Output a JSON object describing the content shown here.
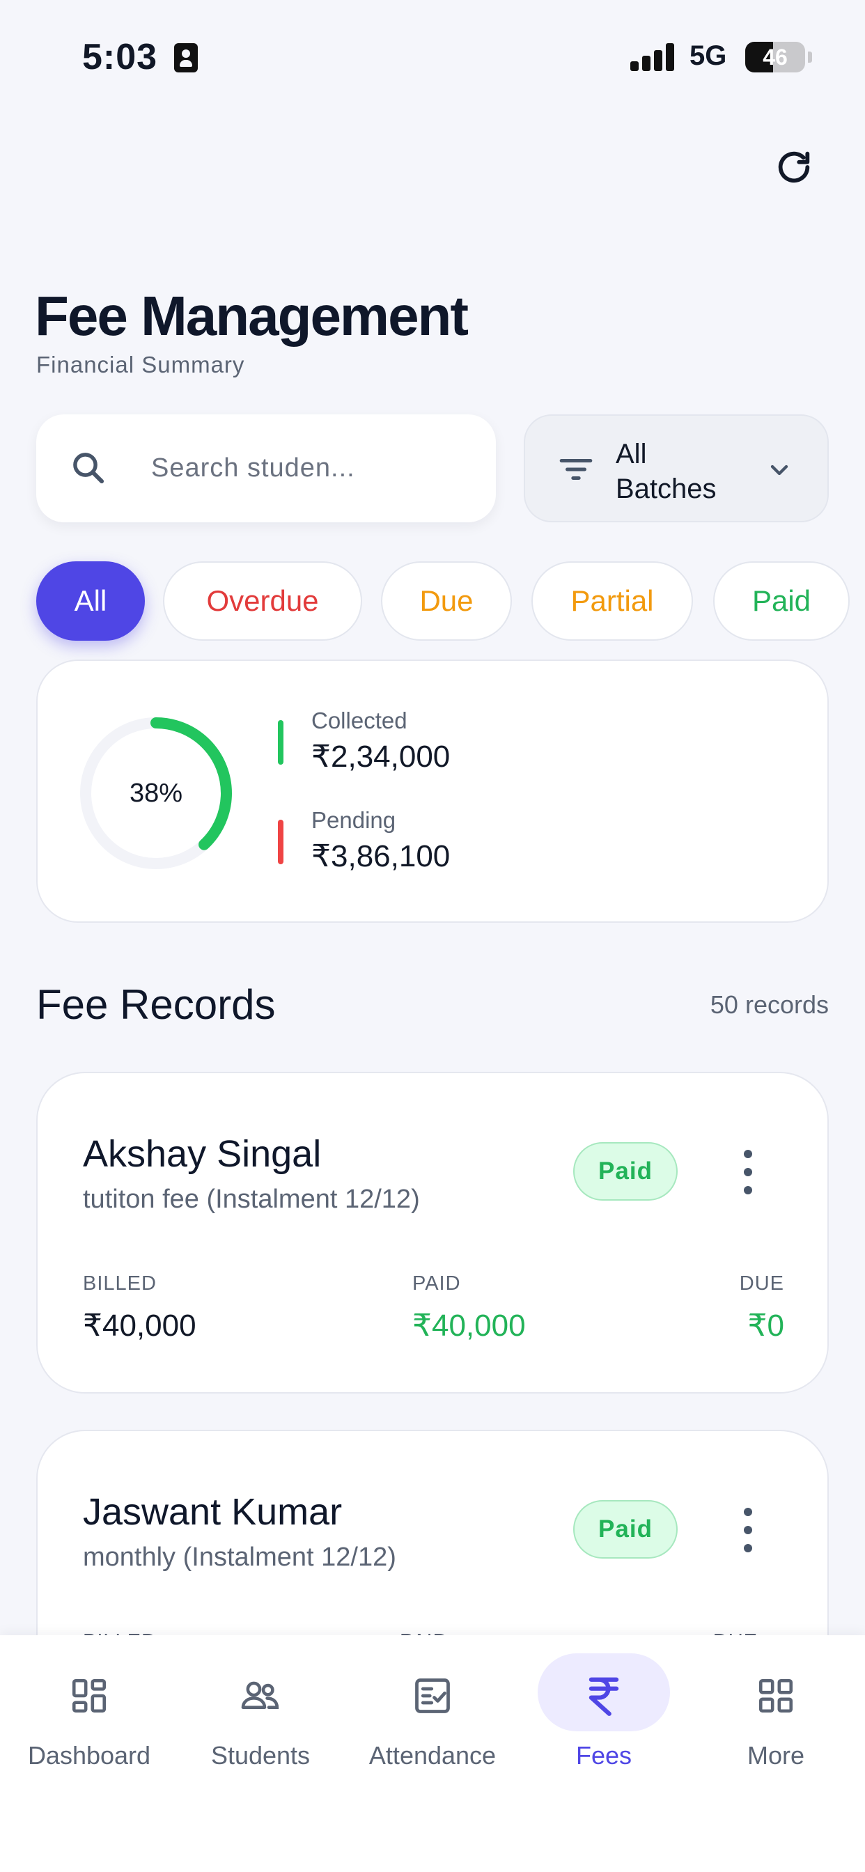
{
  "status_bar": {
    "time": "5:03",
    "network": "5G",
    "battery": "46",
    "battery_level": 0.46
  },
  "header": {
    "title": "Fee Management",
    "subtitle": "Financial Summary"
  },
  "search": {
    "placeholder": "Search studen..."
  },
  "batch_filter": {
    "selected": "All Batches"
  },
  "filter_chips": [
    {
      "label": "All",
      "active": true,
      "color": "#4F46E5"
    },
    {
      "label": "Overdue",
      "active": false,
      "color": "#E23B3B"
    },
    {
      "label": "Due",
      "active": false,
      "color": "#F29A0E"
    },
    {
      "label": "Partial",
      "active": false,
      "color": "#F29A0E"
    },
    {
      "label": "Paid",
      "active": false,
      "color": "#22B358"
    }
  ],
  "summary": {
    "percent_label": "38%",
    "percent_value": 0.38,
    "collected_label": "Collected",
    "collected_value": "₹2,34,000",
    "pending_label": "Pending",
    "pending_value": "₹3,86,100"
  },
  "records": {
    "title": "Fee Records",
    "count": "50 records",
    "items": [
      {
        "name": "Akshay Singal",
        "description": "tutiton fee (Instalment 12/12)",
        "status": "Paid",
        "billed_label": "BILLED",
        "billed": "₹40,000",
        "paid_label": "PAID",
        "paid": "₹40,000",
        "due_label": "DUE",
        "due": "₹0"
      },
      {
        "name": "Jaswant Kumar",
        "description": "monthly (Instalment 12/12)",
        "status": "Paid",
        "billed_label": "BILLED",
        "billed": "",
        "paid_label": "PAID",
        "paid": "",
        "due_label": "DUE",
        "due": ""
      }
    ]
  },
  "bottom_nav": [
    {
      "label": "Dashboard",
      "icon": "dashboard-icon",
      "active": false
    },
    {
      "label": "Students",
      "icon": "students-icon",
      "active": false
    },
    {
      "label": "Attendance",
      "icon": "attendance-icon",
      "active": false
    },
    {
      "label": "Fees",
      "icon": "rupee-icon",
      "active": true
    },
    {
      "label": "More",
      "icon": "grid-icon",
      "active": false
    }
  ],
  "colors": {
    "accent": "#4F46E5",
    "success": "#22C55E",
    "danger": "#EF4444",
    "warning": "#F29A0E"
  }
}
